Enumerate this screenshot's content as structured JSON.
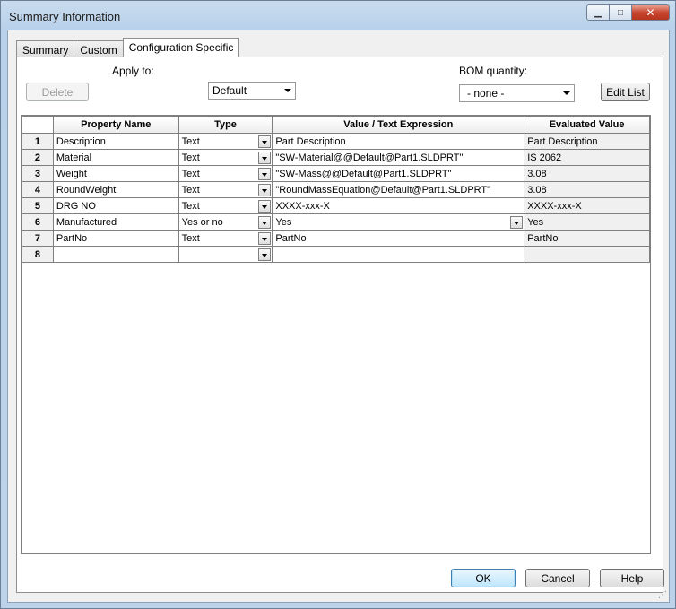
{
  "window": {
    "title": "Summary Information",
    "minimize_glyph": "▁",
    "maximize_glyph": "□",
    "close_glyph": "✕"
  },
  "tabs": [
    {
      "label": "Summary",
      "active": false
    },
    {
      "label": "Custom",
      "active": false
    },
    {
      "label": "Configuration Specific",
      "active": true
    }
  ],
  "toolbar": {
    "delete_label": "Delete",
    "apply_to_label": "Apply to:",
    "apply_to_value": "Default",
    "bom_quantity_label": "BOM quantity:",
    "bom_quantity_value": "- none -",
    "edit_list_label": "Edit List"
  },
  "table": {
    "headers": [
      "",
      "Property Name",
      "Type",
      "Value / Text Expression",
      "Evaluated Value"
    ],
    "rows": [
      {
        "num": "1",
        "name": "Description",
        "type": "Text",
        "value": "Part Description",
        "evaluated": "Part Description"
      },
      {
        "num": "2",
        "name": "Material",
        "type": "Text",
        "value": "\"SW-Material@@Default@Part1.SLDPRT\"",
        "evaluated": "IS 2062"
      },
      {
        "num": "3",
        "name": "Weight",
        "type": "Text",
        "value": "\"SW-Mass@@Default@Part1.SLDPRT\"",
        "evaluated": "3.08"
      },
      {
        "num": "4",
        "name": "RoundWeight",
        "type": "Text",
        "value": "\"RoundMassEquation@Default@Part1.SLDPRT\"",
        "evaluated": "3.08"
      },
      {
        "num": "5",
        "name": "DRG NO",
        "type": "Text",
        "value": "XXXX-xxx-X",
        "evaluated": "XXXX-xxx-X"
      },
      {
        "num": "6",
        "name": "Manufactured",
        "type": "Yes or no",
        "value": "Yes",
        "evaluated": "Yes"
      },
      {
        "num": "7",
        "name": "PartNo",
        "type": "Text",
        "value": "PartNo",
        "evaluated": "PartNo"
      },
      {
        "num": "8",
        "name": "",
        "type": "",
        "value": "",
        "evaluated": ""
      }
    ]
  },
  "footer": {
    "ok_label": "OK",
    "cancel_label": "Cancel",
    "help_label": "Help"
  }
}
